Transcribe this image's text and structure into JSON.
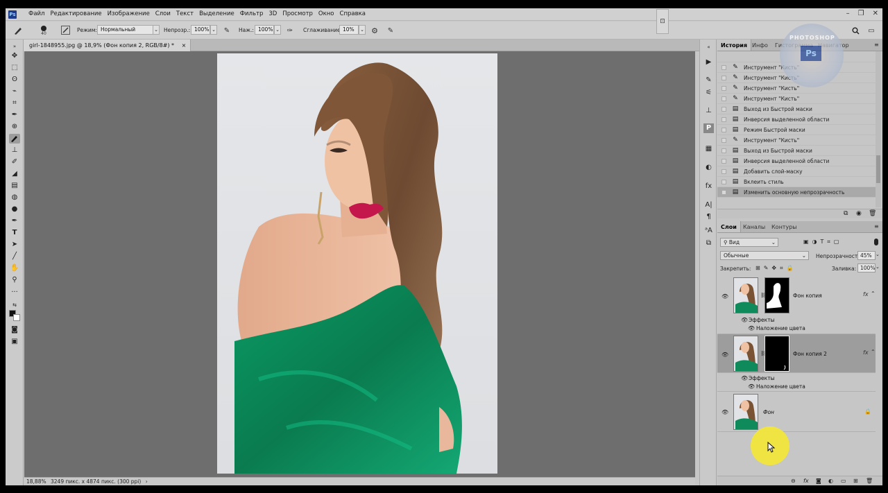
{
  "menu": {
    "items": [
      "Файл",
      "Редактирование",
      "Изображение",
      "Слои",
      "Текст",
      "Выделение",
      "Фильтр",
      "3D",
      "Просмотр",
      "Окно",
      "Справка"
    ],
    "window_controls": [
      "–",
      "❐",
      "✕"
    ]
  },
  "options": {
    "brush_size": "40",
    "mode_label": "Режим:",
    "mode_value": "Нормальный",
    "opacity_label": "Непрозр.:",
    "opacity_value": "100%",
    "flow_label": "Наж.:",
    "flow_value": "100%",
    "smoothing_label": "Сглаживание:",
    "smoothing_value": "10%"
  },
  "document": {
    "tab_title": "girl-1848955.jpg @ 18,9% (Фон копия 2, RGB/8#) *",
    "tab_close": "×"
  },
  "status": {
    "zoom": "18,88%",
    "info": "3249 пикс. x 4874 пикс. (300 ppi)",
    "arrow": "›"
  },
  "history_panel": {
    "tabs": [
      "История",
      "Инфо",
      "Гистограмма",
      "Навигатор"
    ],
    "rows": [
      {
        "icon": "brush-icon",
        "label": "Инструмент \"Кисть\""
      },
      {
        "icon": "brush-icon",
        "label": "Инструмент \"Кисть\""
      },
      {
        "icon": "brush-icon",
        "label": "Инструмент \"Кисть\""
      },
      {
        "icon": "brush-icon",
        "label": "Инструмент \"Кисть\""
      },
      {
        "icon": "brush-icon",
        "label": "Инструмент \"Кисть\""
      },
      {
        "icon": "doc-icon",
        "label": "Выход из Быстрой маски"
      },
      {
        "icon": "doc-icon",
        "label": "Инверсия выделенной области"
      },
      {
        "icon": "doc-icon",
        "label": "Режим Быстрой маски"
      },
      {
        "icon": "brush-icon",
        "label": "Инструмент \"Кисть\""
      },
      {
        "icon": "doc-icon",
        "label": "Выход из Быстрой маски"
      },
      {
        "icon": "doc-icon",
        "label": "Инверсия выделенной области"
      },
      {
        "icon": "doc-icon",
        "label": "Добавить слой-маску"
      },
      {
        "icon": "doc-icon",
        "label": "Вклеить стиль"
      },
      {
        "icon": "doc-icon",
        "label": "Изменить основную непрозрачность",
        "selected": true
      }
    ]
  },
  "layers_panel": {
    "tabs": [
      "Слои",
      "Каналы",
      "Контуры"
    ],
    "filter_label": "Вид",
    "blend_mode": "Обычные",
    "opacity_label": "Непрозрачность:",
    "opacity_value": "45%",
    "lock_label": "Закрепить:",
    "fill_label": "Заливка:",
    "fill_value": "100%",
    "layers": [
      {
        "name": "Фон копия",
        "effects_label": "Эффекты",
        "effect": "Наложение цвета"
      },
      {
        "name": "Фон копия 2",
        "effects_label": "Эффекты",
        "effect": "Наложение цвета",
        "selected": true
      },
      {
        "name": "Фон"
      }
    ],
    "fx": "fx"
  },
  "watermark_text": "PHOTOSHOP",
  "colors": {
    "dress": "#0f8a5a",
    "hair": "#7a5234",
    "skin": "#e9b79b",
    "lips": "#c4174c",
    "canvas_bg": "#6e6e6e",
    "cursor_highlight": "#f3e63d"
  }
}
